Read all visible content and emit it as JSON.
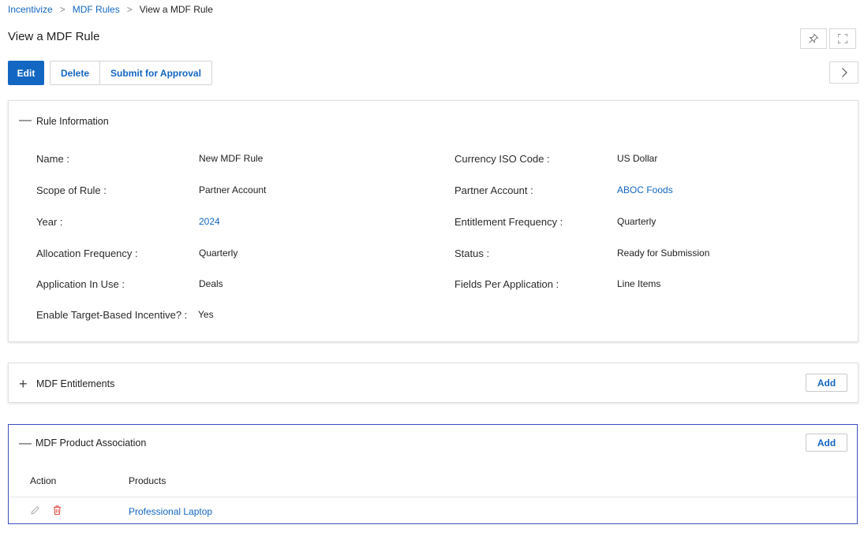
{
  "breadcrumb": {
    "items": [
      "Incentivize",
      "MDF Rules"
    ],
    "current": "View a MDF Rule"
  },
  "page": {
    "title": "View a MDF Rule"
  },
  "toolbar": {
    "edit": "Edit",
    "delete": "Delete",
    "submit": "Submit for Approval"
  },
  "icons": {
    "pin": "pin-icon",
    "expand": "expand-icon",
    "next": "chevron-right-icon",
    "collapse": "minus-icon",
    "expand_section": "plus-icon",
    "edit": "pencil-icon",
    "delete": "trash-icon"
  },
  "rule_info": {
    "title": "Rule Information",
    "left": [
      {
        "label": "Name :",
        "value": "New MDF Rule",
        "link": false
      },
      {
        "label": "Scope of Rule :",
        "value": "Partner Account",
        "link": false
      },
      {
        "label": "Year :",
        "value": "2024",
        "link": true
      },
      {
        "label": "Allocation Frequency :",
        "value": "Quarterly",
        "link": false
      },
      {
        "label": "Application In Use :",
        "value": "Deals",
        "link": false
      },
      {
        "label": "Enable Target-Based Incentive? :",
        "value": "Yes",
        "link": false
      }
    ],
    "right": [
      {
        "label": "Currency ISO Code :",
        "value": "US Dollar",
        "link": false
      },
      {
        "label": "Partner Account :",
        "value": "ABOC Foods",
        "link": true
      },
      {
        "label": "Entitlement Frequency :",
        "value": "Quarterly",
        "link": false
      },
      {
        "label": "Status :",
        "value": "Ready for Submission",
        "link": false
      },
      {
        "label": "Fields Per Application :",
        "value": "Line Items",
        "link": false
      }
    ]
  },
  "entitlements": {
    "title": "MDF Entitlements",
    "add": "Add"
  },
  "product_association": {
    "title": "MDF Product Association",
    "add": "Add",
    "columns": [
      "Action",
      "Products"
    ],
    "rows": [
      {
        "product": "Professional Laptop"
      }
    ]
  },
  "colors": {
    "accent": "#1367c2",
    "link": "#1366c1",
    "danger": "#e0463f",
    "focus_border": "#3b4fbf"
  }
}
